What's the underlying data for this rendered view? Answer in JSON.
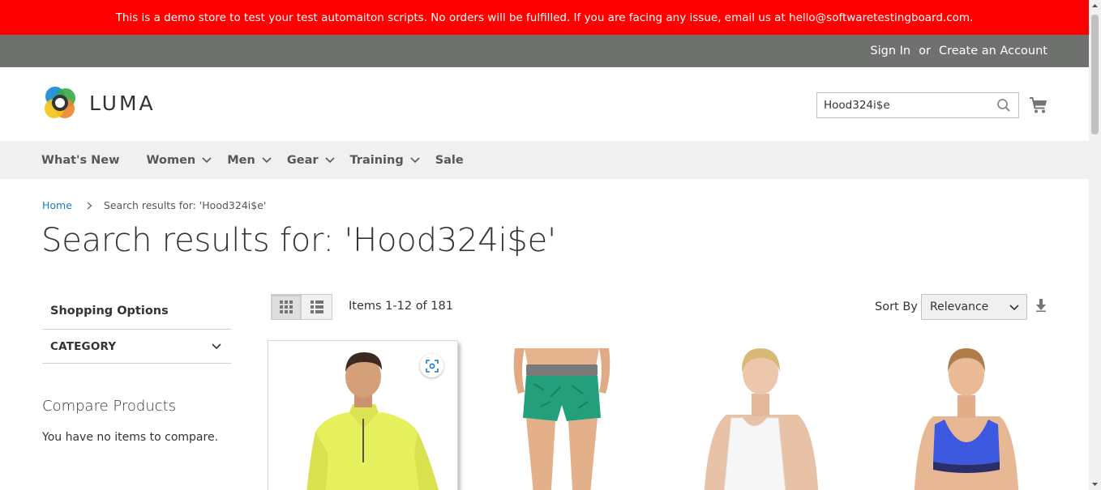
{
  "banner": {
    "text": "This is a demo store to test your test automaiton scripts. No orders will be fulfilled. If you are facing any issue, email us at hello@softwaretestingboard.com."
  },
  "header_links": {
    "sign_in": "Sign In",
    "or": "or",
    "create_account": "Create an Account"
  },
  "logo": {
    "text": "LUMA"
  },
  "search": {
    "value": "Hood324i$e"
  },
  "nav": {
    "items": [
      {
        "label": "What's New",
        "has_dropdown": false
      },
      {
        "label": "Women",
        "has_dropdown": true
      },
      {
        "label": "Men",
        "has_dropdown": true
      },
      {
        "label": "Gear",
        "has_dropdown": true
      },
      {
        "label": "Training",
        "has_dropdown": true
      },
      {
        "label": "Sale",
        "has_dropdown": false
      }
    ]
  },
  "breadcrumb": {
    "home": "Home",
    "current": "Search results for: 'Hood324i$e'"
  },
  "page_title": "Search results for: 'Hood324i$e'",
  "sidebar": {
    "shopping_options": "Shopping Options",
    "filter_category": "Category",
    "compare_title": "Compare Products",
    "compare_empty": "You have no items to compare."
  },
  "toolbar": {
    "items_count": "Items 1-12 of 181",
    "sort_label": "Sort By",
    "sort_value": "Relevance"
  },
  "products": [
    {
      "image": "man-yellow-quarter-zip-pullover",
      "hovered": true
    },
    {
      "image": "woman-green-shorts",
      "hovered": false
    },
    {
      "image": "woman-white-tank-top",
      "hovered": false
    },
    {
      "image": "woman-blue-sports-bra",
      "hovered": false
    }
  ],
  "colors": {
    "banner_bg": "#ff0000",
    "top_links_bg": "#6e716e",
    "nav_bg": "#f0f0f0",
    "link": "#1979c3"
  }
}
